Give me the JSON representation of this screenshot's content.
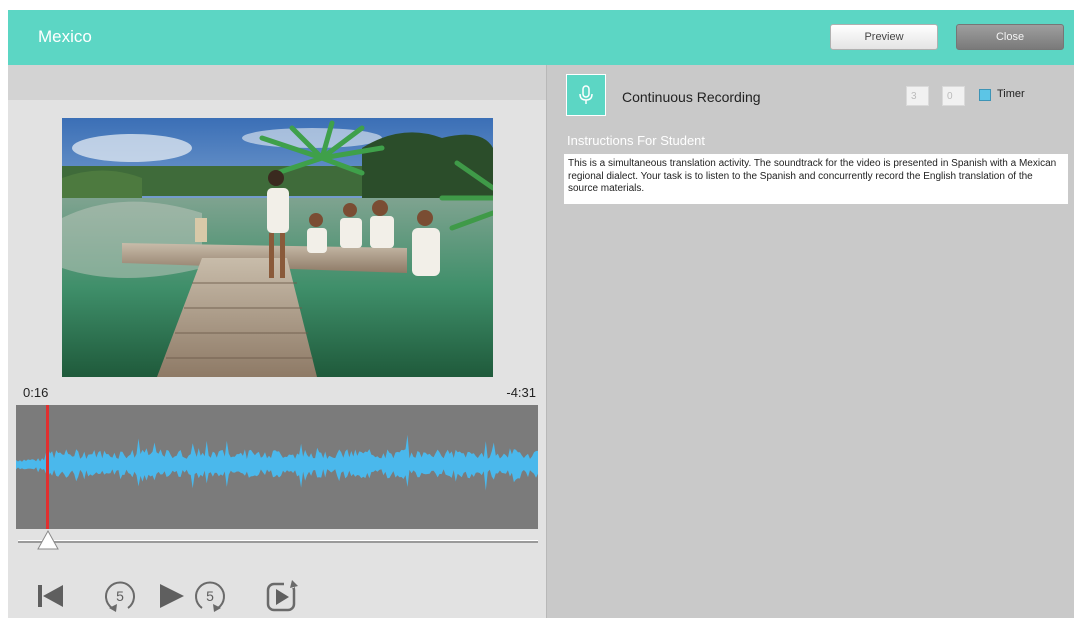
{
  "app": {
    "title": "Mexico"
  },
  "header": {
    "preview_label": "Preview",
    "close_label": "Close"
  },
  "player": {
    "time_elapsed": "0:16",
    "time_remaining": "-4:31",
    "skip_back_seconds": "5",
    "skip_forward_seconds": "5"
  },
  "recording": {
    "mode_label": "Continuous Recording",
    "timer_minutes": "3",
    "timer_seconds": "0",
    "timer_label": "Timer",
    "timer_checked": false
  },
  "instructions": {
    "heading": "Instructions For Student",
    "text": "This is a simultaneous translation activity.  The soundtrack for the video is presented in Spanish with a Mexican regional dialect.  Your task is to listen to the Spanish and concurrently record the English translation of the source materials."
  },
  "colors": {
    "accent": "#5cd6c4",
    "waveform": "#4ab8ec",
    "playhead": "#e03030"
  }
}
